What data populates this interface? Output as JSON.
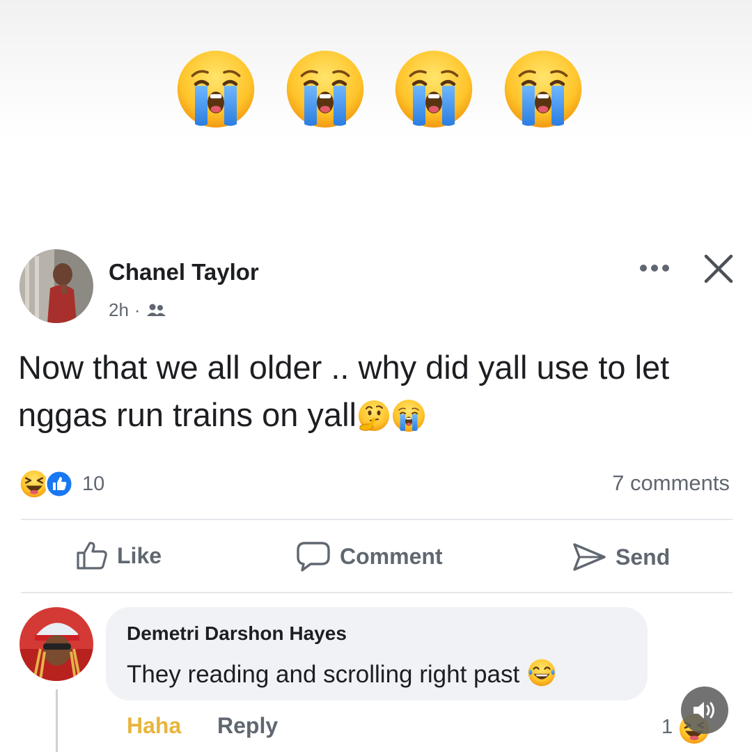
{
  "header_emojis": [
    "loudly-crying-face",
    "loudly-crying-face",
    "loudly-crying-face",
    "loudly-crying-face"
  ],
  "post": {
    "author": "Chanel Taylor",
    "time": "2h",
    "separator": "·",
    "audience_icon": "friends-icon",
    "text": "Now that we all older .. why did yall use to let nggas run trains on yall",
    "text_emojis": [
      "thinking-face",
      "loudly-crying-face"
    ],
    "reactions": {
      "icons": [
        "haha-reaction",
        "like-reaction"
      ],
      "count": "10"
    },
    "comments_count": "7 comments"
  },
  "actions": {
    "like": "Like",
    "comment": "Comment",
    "send": "Send"
  },
  "comment": {
    "author": "Demetri Darshon Hayes",
    "text": "They reading and scrolling right past",
    "text_emoji": "face-with-tears-of-joy",
    "haha_label": "Haha",
    "reply_label": "Reply",
    "reaction_count": "1"
  },
  "colors": {
    "haha_link": "#e8b53c",
    "like_blue": "#1877f2",
    "muted_text": "#606770",
    "bubble_bg": "#f0f2f5"
  }
}
